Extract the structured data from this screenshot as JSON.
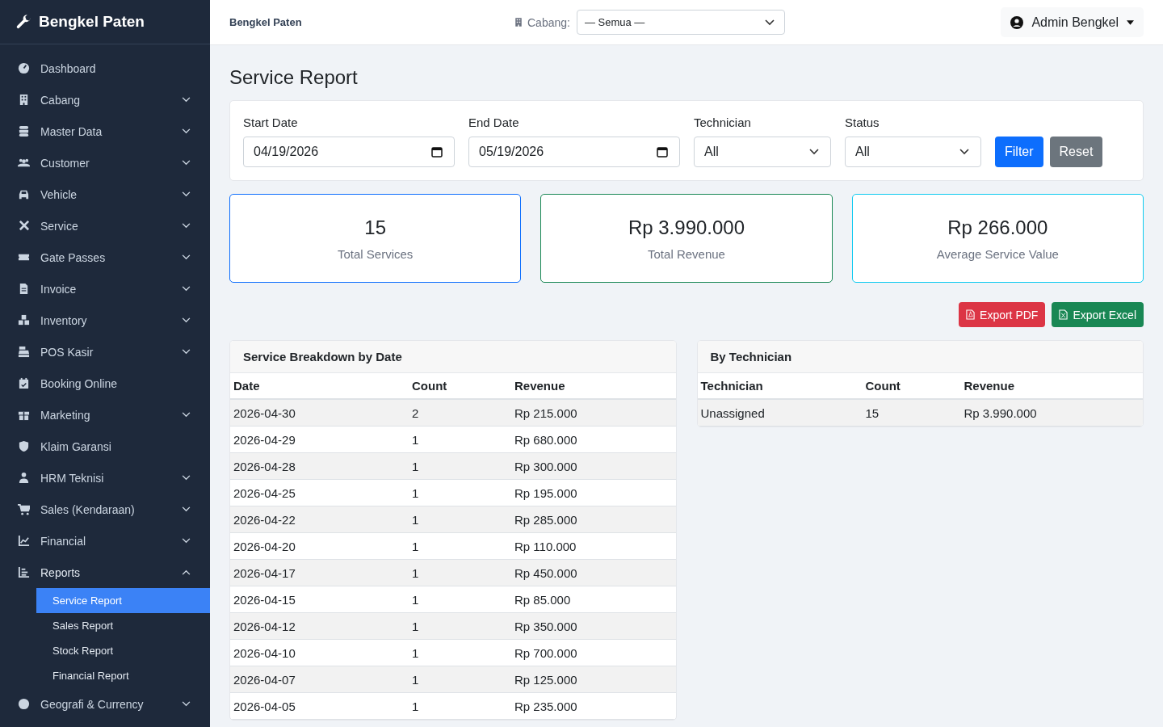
{
  "brand": "Bengkel Paten",
  "sidebar": {
    "items": [
      {
        "label": "Dashboard",
        "has_submenu": false,
        "expanded": false
      },
      {
        "label": "Cabang",
        "has_submenu": true,
        "expanded": false
      },
      {
        "label": "Master Data",
        "has_submenu": true,
        "expanded": false
      },
      {
        "label": "Customer",
        "has_submenu": true,
        "expanded": false
      },
      {
        "label": "Vehicle",
        "has_submenu": true,
        "expanded": false
      },
      {
        "label": "Service",
        "has_submenu": true,
        "expanded": false
      },
      {
        "label": "Gate Passes",
        "has_submenu": true,
        "expanded": false
      },
      {
        "label": "Invoice",
        "has_submenu": true,
        "expanded": false
      },
      {
        "label": "Inventory",
        "has_submenu": true,
        "expanded": false
      },
      {
        "label": "POS Kasir",
        "has_submenu": true,
        "expanded": false
      },
      {
        "label": "Booking Online",
        "has_submenu": false,
        "expanded": false
      },
      {
        "label": "Marketing",
        "has_submenu": true,
        "expanded": false
      },
      {
        "label": "Klaim Garansi",
        "has_submenu": false,
        "expanded": false
      },
      {
        "label": "HRM Teknisi",
        "has_submenu": true,
        "expanded": false
      },
      {
        "label": "Sales (Kendaraan)",
        "has_submenu": true,
        "expanded": false
      },
      {
        "label": "Financial",
        "has_submenu": true,
        "expanded": false
      },
      {
        "label": "Reports",
        "has_submenu": true,
        "expanded": true,
        "children": [
          {
            "label": "Service Report",
            "selected": true
          },
          {
            "label": "Sales Report",
            "selected": false
          },
          {
            "label": "Stock Report",
            "selected": false
          },
          {
            "label": "Financial Report",
            "selected": false
          }
        ]
      },
      {
        "label": "Geografi & Currency",
        "has_submenu": true,
        "expanded": false
      }
    ]
  },
  "topbar": {
    "title": "Bengkel Paten",
    "branch_label": "Cabang:",
    "branch_value": "— Semua —",
    "user": "Admin Bengkel"
  },
  "page_title": "Service Report",
  "filters": [
    {
      "kind": "date",
      "label": "Start Date",
      "value": "04/19/2026"
    },
    {
      "kind": "date",
      "label": "End Date",
      "value": "05/19/2026"
    },
    {
      "kind": "select",
      "label": "Technician",
      "value": "All"
    },
    {
      "kind": "select",
      "label": "Status",
      "value": "All"
    }
  ],
  "filter_buttons": [
    {
      "kind": "primary",
      "label": "Filter"
    },
    {
      "kind": "secondary",
      "label": "Reset"
    }
  ],
  "stats": [
    {
      "value": "15",
      "label": "Total Services",
      "color": "#0d6efd"
    },
    {
      "value": "Rp 3.990.000",
      "label": "Total Revenue",
      "color": "#198754"
    },
    {
      "value": "Rp 266.000",
      "label": "Average Service Value",
      "color": "#0dcaf0"
    }
  ],
  "export_buttons": [
    {
      "kind": "pdf",
      "label": "Export PDF"
    },
    {
      "kind": "excel",
      "label": "Export Excel"
    }
  ],
  "breakdown": {
    "title": "Service Breakdown by Date",
    "columns": [
      "Date",
      "Count",
      "Revenue"
    ],
    "rows": [
      [
        "2026-04-30",
        "2",
        "Rp 215.000"
      ],
      [
        "2026-04-29",
        "1",
        "Rp 680.000"
      ],
      [
        "2026-04-28",
        "1",
        "Rp 300.000"
      ],
      [
        "2026-04-25",
        "1",
        "Rp 195.000"
      ],
      [
        "2026-04-22",
        "1",
        "Rp 285.000"
      ],
      [
        "2026-04-20",
        "1",
        "Rp 110.000"
      ],
      [
        "2026-04-17",
        "1",
        "Rp 450.000"
      ],
      [
        "2026-04-15",
        "1",
        "Rp 85.000"
      ],
      [
        "2026-04-12",
        "1",
        "Rp 350.000"
      ],
      [
        "2026-04-10",
        "1",
        "Rp 700.000"
      ],
      [
        "2026-04-07",
        "1",
        "Rp 125.000"
      ],
      [
        "2026-04-05",
        "1",
        "Rp 235.000"
      ]
    ]
  },
  "by_technician": {
    "title": "By Technician",
    "columns": [
      "Technician",
      "Count",
      "Revenue"
    ],
    "rows": [
      [
        "Unassigned",
        "15",
        "Rp 3.990.000"
      ]
    ]
  }
}
